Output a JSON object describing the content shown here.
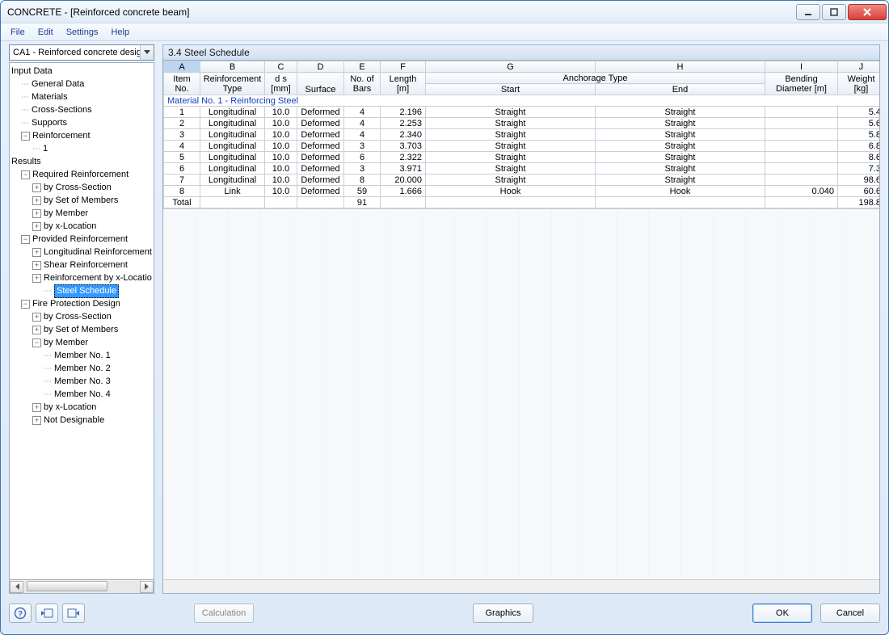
{
  "title": "CONCRETE - [Reinforced concrete beam]",
  "menu": {
    "file": "File",
    "edit": "Edit",
    "settings": "Settings",
    "help": "Help"
  },
  "combo": "CA1 - Reinforced concrete desig",
  "tree": {
    "input_data": "Input Data",
    "general_data": "General Data",
    "materials": "Materials",
    "cross_sections": "Cross-Sections",
    "supports": "Supports",
    "reinforcement": "Reinforcement",
    "reinf_1": "1",
    "results": "Results",
    "required": "Required Reinforcement",
    "by_cross_section": "by Cross-Section",
    "by_set_members": "by Set of Members",
    "by_member": "by Member",
    "by_x_location": "by x-Location",
    "provided": "Provided Reinforcement",
    "longitudinal_reinf": "Longitudinal Reinforcement",
    "shear_reinf": "Shear Reinforcement",
    "reinf_by_x": "Reinforcement by x-Locatio",
    "steel_schedule": "Steel Schedule",
    "fire_protection": "Fire Protection Design",
    "member_no_1": "Member No. 1",
    "member_no_2": "Member No. 2",
    "member_no_3": "Member No. 3",
    "member_no_4": "Member No. 4",
    "not_designable": "Not Designable"
  },
  "panel_title": "3.4 Steel Schedule",
  "letters": [
    "A",
    "B",
    "C",
    "D",
    "E",
    "F",
    "G",
    "H",
    "I",
    "J"
  ],
  "headers": {
    "item_no_1": "Item",
    "item_no_2": "No.",
    "reinf_type_1": "Reinforcement",
    "reinf_type_2": "Type",
    "ds_1": "d s",
    "ds_2": "[mm]",
    "surface": "Surface",
    "bars_1": "No. of",
    "bars_2": "Bars",
    "length_1": "Length",
    "length_2": "[m]",
    "anchorage": "Anchorage Type",
    "start": "Start",
    "end": "End",
    "bending_1": "Bending",
    "bending_2": "Diameter [m]",
    "weight_1": "Weight",
    "weight_2": "[kg]"
  },
  "section_row": "Material No. 1  -  Reinforcing Steel",
  "rows": [
    {
      "no": "1",
      "type": "Longitudinal",
      "ds": "10.0",
      "surface": "Deformed",
      "bars": "4",
      "len": "2.196",
      "start": "Straight",
      "end": "Straight",
      "bend": "",
      "wt": "5.4"
    },
    {
      "no": "2",
      "type": "Longitudinal",
      "ds": "10.0",
      "surface": "Deformed",
      "bars": "4",
      "len": "2.253",
      "start": "Straight",
      "end": "Straight",
      "bend": "",
      "wt": "5.6"
    },
    {
      "no": "3",
      "type": "Longitudinal",
      "ds": "10.0",
      "surface": "Deformed",
      "bars": "4",
      "len": "2.340",
      "start": "Straight",
      "end": "Straight",
      "bend": "",
      "wt": "5.8"
    },
    {
      "no": "4",
      "type": "Longitudinal",
      "ds": "10.0",
      "surface": "Deformed",
      "bars": "3",
      "len": "3.703",
      "start": "Straight",
      "end": "Straight",
      "bend": "",
      "wt": "6.8"
    },
    {
      "no": "5",
      "type": "Longitudinal",
      "ds": "10.0",
      "surface": "Deformed",
      "bars": "6",
      "len": "2.322",
      "start": "Straight",
      "end": "Straight",
      "bend": "",
      "wt": "8.6"
    },
    {
      "no": "6",
      "type": "Longitudinal",
      "ds": "10.0",
      "surface": "Deformed",
      "bars": "3",
      "len": "3.971",
      "start": "Straight",
      "end": "Straight",
      "bend": "",
      "wt": "7.3"
    },
    {
      "no": "7",
      "type": "Longitudinal",
      "ds": "10.0",
      "surface": "Deformed",
      "bars": "8",
      "len": "20.000",
      "start": "Straight",
      "end": "Straight",
      "bend": "",
      "wt": "98.6"
    },
    {
      "no": "8",
      "type": "Link",
      "ds": "10.0",
      "surface": "Deformed",
      "bars": "59",
      "len": "1.666",
      "start": "Hook",
      "end": "Hook",
      "bend": "0.040",
      "wt": "60.6"
    }
  ],
  "total_label": "Total",
  "total_bars": "91",
  "total_weight": "198.8",
  "footer": {
    "calculation": "Calculation",
    "graphics": "Graphics",
    "ok": "OK",
    "cancel": "Cancel"
  }
}
